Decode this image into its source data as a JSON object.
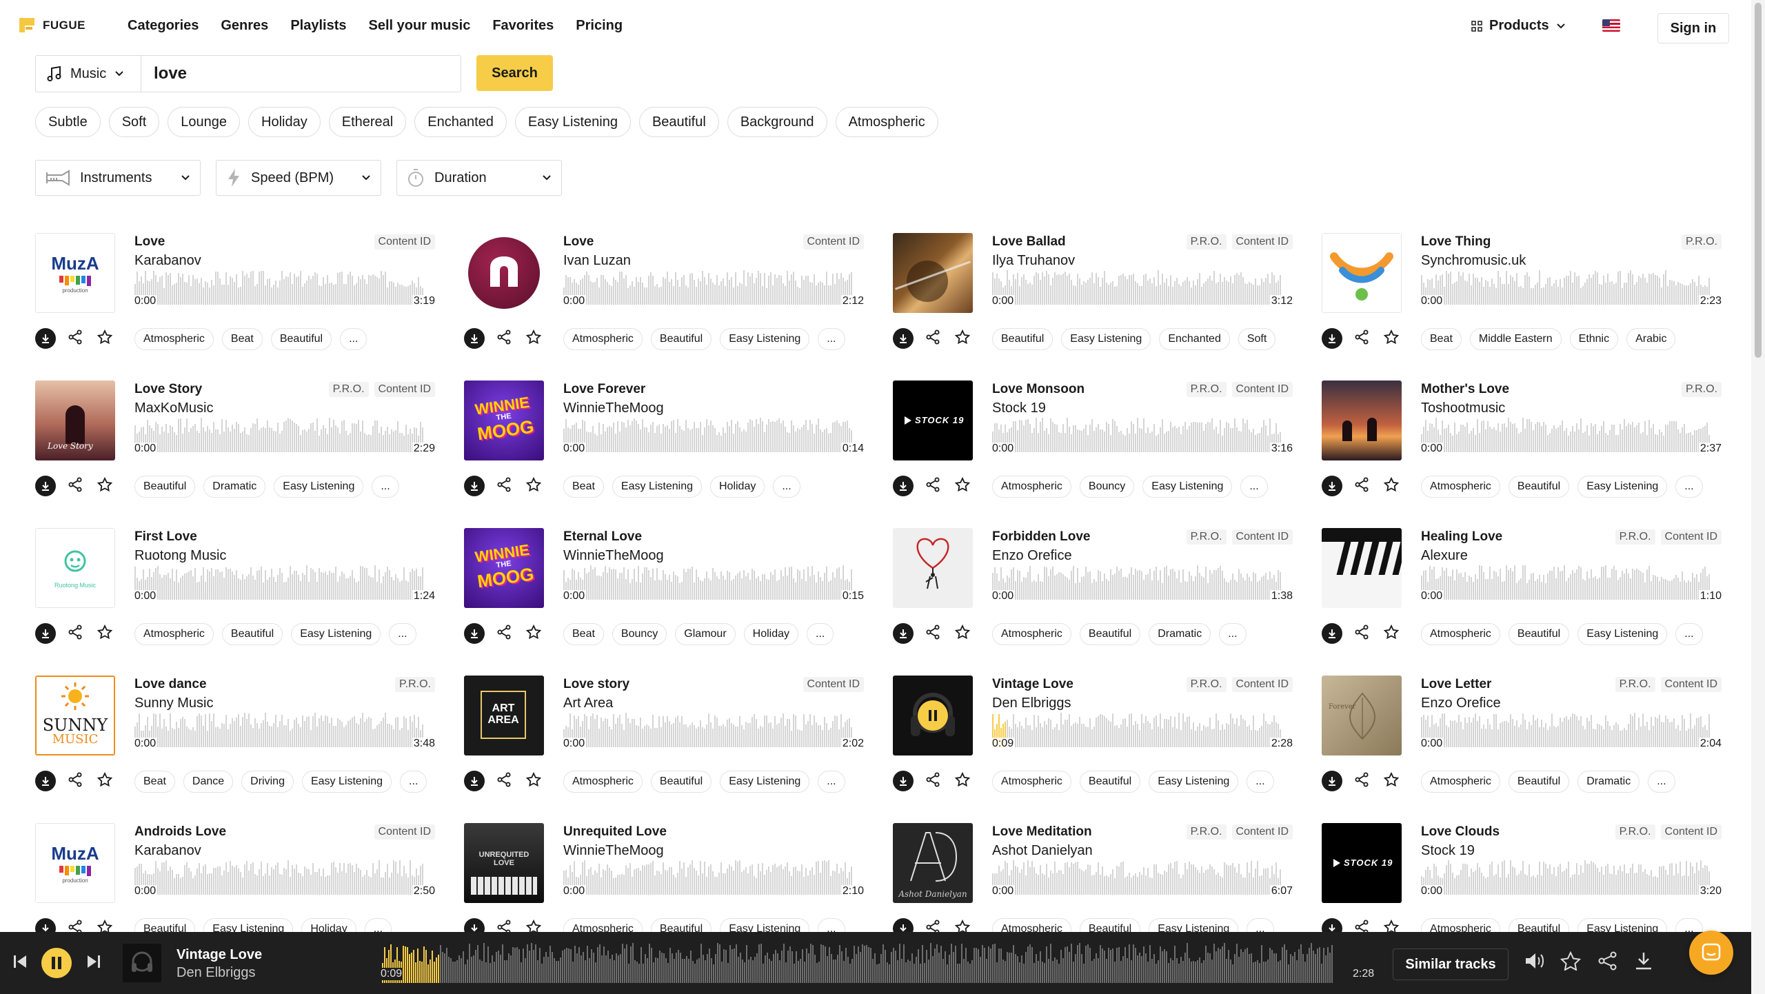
{
  "brand": "FUGUE",
  "nav": [
    "Categories",
    "Genres",
    "Playlists",
    "Sell your music",
    "Favorites",
    "Pricing"
  ],
  "header": {
    "products": "Products",
    "sign_in": "Sign in"
  },
  "search": {
    "type": "Music",
    "query": "love",
    "button": "Search"
  },
  "tags": [
    "Subtle",
    "Soft",
    "Lounge",
    "Holiday",
    "Ethereal",
    "Enchanted",
    "Easy Listening",
    "Beautiful",
    "Background",
    "Atmospheric"
  ],
  "filters": [
    {
      "label": "Instruments",
      "icon": "trumpet-icon"
    },
    {
      "label": "Speed (BPM)",
      "icon": "lightning-icon"
    },
    {
      "label": "Duration",
      "icon": "stopwatch-icon"
    }
  ],
  "tracks": [
    {
      "title": "Love",
      "artist": "Karabanov",
      "pro": false,
      "content_id": true,
      "current": "0:00",
      "duration": "3:19",
      "tags": [
        "Atmospheric",
        "Beat",
        "Beautiful",
        "..."
      ],
      "art": "muza"
    },
    {
      "title": "Love",
      "artist": "Ivan Luzan",
      "pro": false,
      "content_id": true,
      "current": "0:00",
      "duration": "2:12",
      "tags": [
        "Atmospheric",
        "Beautiful",
        "Easy Listening",
        "..."
      ],
      "art": "circle"
    },
    {
      "title": "Love Ballad",
      "artist": "Ilya Truhanov",
      "pro": true,
      "content_id": true,
      "current": "0:00",
      "duration": "3:12",
      "tags": [
        "Beautiful",
        "Easy Listening",
        "Enchanted",
        "Soft"
      ],
      "art": "guitar"
    },
    {
      "title": "Love Thing",
      "artist": "Synchromusic.uk",
      "pro": true,
      "content_id": false,
      "current": "0:00",
      "duration": "2:23",
      "tags": [
        "Beat",
        "Middle Eastern",
        "Ethnic",
        "Arabic"
      ],
      "art": "smile"
    },
    {
      "title": "Love Story",
      "artist": "MaxKoMusic",
      "pro": true,
      "content_id": true,
      "current": "0:00",
      "duration": "2:29",
      "tags": [
        "Beautiful",
        "Dramatic",
        "Easy Listening",
        "..."
      ],
      "art": "couple"
    },
    {
      "title": "Love Forever",
      "artist": "WinnieTheMoog",
      "pro": false,
      "content_id": false,
      "current": "0:00",
      "duration": "0:14",
      "tags": [
        "Beat",
        "Easy Listening",
        "Holiday",
        "..."
      ],
      "art": "winnie"
    },
    {
      "title": "Love Monsoon",
      "artist": "Stock 19",
      "pro": true,
      "content_id": true,
      "current": "0:00",
      "duration": "3:16",
      "tags": [
        "Atmospheric",
        "Bouncy",
        "Easy Listening",
        "..."
      ],
      "art": "stock19"
    },
    {
      "title": "Mother's Love",
      "artist": "Toshootmusic",
      "pro": true,
      "content_id": false,
      "current": "0:00",
      "duration": "2:37",
      "tags": [
        "Atmospheric",
        "Beautiful",
        "Easy Listening",
        "..."
      ],
      "art": "sunset"
    },
    {
      "title": "First Love",
      "artist": "Ruotong Music",
      "pro": false,
      "content_id": false,
      "current": "0:00",
      "duration": "1:24",
      "tags": [
        "Atmospheric",
        "Beautiful",
        "Easy Listening",
        "..."
      ],
      "art": "ruotong"
    },
    {
      "title": "Eternal Love",
      "artist": "WinnieTheMoog",
      "pro": false,
      "content_id": false,
      "current": "0:00",
      "duration": "0:15",
      "tags": [
        "Beat",
        "Bouncy",
        "Glamour",
        "Holiday",
        "..."
      ],
      "art": "winnie"
    },
    {
      "title": "Forbidden Love",
      "artist": "Enzo Orefice",
      "pro": true,
      "content_id": true,
      "current": "0:00",
      "duration": "1:38",
      "tags": [
        "Atmospheric",
        "Beautiful",
        "Dramatic",
        "..."
      ],
      "art": "heart"
    },
    {
      "title": "Healing Love",
      "artist": "Alexure",
      "pro": true,
      "content_id": true,
      "current": "0:00",
      "duration": "1:10",
      "tags": [
        "Atmospheric",
        "Beautiful",
        "Easy Listening",
        "..."
      ],
      "art": "piano"
    },
    {
      "title": "Love dance",
      "artist": "Sunny Music",
      "pro": true,
      "content_id": false,
      "current": "0:00",
      "duration": "3:48",
      "tags": [
        "Beat",
        "Dance",
        "Driving",
        "Easy Listening",
        "..."
      ],
      "art": "sunny"
    },
    {
      "title": "Love story",
      "artist": "Art Area",
      "pro": false,
      "content_id": true,
      "current": "0:00",
      "duration": "2:02",
      "tags": [
        "Atmospheric",
        "Beautiful",
        "Easy Listening",
        "..."
      ],
      "art": "artarea"
    },
    {
      "title": "Vintage Love",
      "artist": "Den Elbriggs",
      "pro": true,
      "content_id": true,
      "current": "0:09",
      "duration": "2:28",
      "tags": [
        "Atmospheric",
        "Beautiful",
        "Easy Listening",
        "..."
      ],
      "art": "playing",
      "playing": true
    },
    {
      "title": "Love Letter",
      "artist": "Enzo Orefice",
      "pro": true,
      "content_id": true,
      "current": "0:00",
      "duration": "2:04",
      "tags": [
        "Atmospheric",
        "Beautiful",
        "Dramatic",
        "..."
      ],
      "art": "letter"
    },
    {
      "title": "Androids Love",
      "artist": "Karabanov",
      "pro": false,
      "content_id": true,
      "current": "0:00",
      "duration": "2:50",
      "tags": [
        "Beautiful",
        "Easy Listening",
        "Holiday",
        "..."
      ],
      "art": "muza"
    },
    {
      "title": "Unrequited Love",
      "artist": "WinnieTheMoog",
      "pro": false,
      "content_id": false,
      "current": "0:00",
      "duration": "2:10",
      "tags": [
        "Atmospheric",
        "Beautiful",
        "Easy Listening",
        "..."
      ],
      "art": "unrequited"
    },
    {
      "title": "Love Meditation",
      "artist": "Ashot Danielyan",
      "pro": true,
      "content_id": true,
      "current": "0:00",
      "duration": "6:07",
      "tags": [
        "Atmospheric",
        "Beautiful",
        "Easy Listening",
        "..."
      ],
      "art": "ashot"
    },
    {
      "title": "Love Clouds",
      "artist": "Stock 19",
      "pro": true,
      "content_id": true,
      "current": "0:00",
      "duration": "3:20",
      "tags": [
        "Atmospheric",
        "Beautiful",
        "Easy Listening",
        "..."
      ],
      "art": "stock19"
    }
  ],
  "labels": {
    "pro": "P.R.O.",
    "content_id": "Content ID"
  },
  "art_text": {
    "muza_name": "MuzA",
    "muza_sub": "production",
    "winnie": [
      "WINNIE",
      "THE",
      "MOOG"
    ],
    "stock19": "STOCK 19",
    "sunny": [
      "SUNNY",
      "MUSIC"
    ],
    "artarea": [
      "ART",
      "AREA"
    ],
    "unrequited": [
      "UNREQUITED",
      "LOVE"
    ],
    "ashot_script": "Ashot Danielyan",
    "ruotong": "Ruotong Music",
    "couple": "Love Story",
    "letter": "Forever"
  },
  "player": {
    "title": "Vintage Love",
    "artist": "Den Elbriggs",
    "current": "0:09",
    "duration": "2:28",
    "progress": 0.061,
    "similar": "Similar tracks",
    "state": "playing"
  },
  "colors": {
    "accent": "#f7cc46",
    "player_bg": "#1f1f1f",
    "chat": "#f7a823"
  },
  "icons": [
    "logo-mark",
    "music-note-icon",
    "chevron-down-icon",
    "grid-icon",
    "flag-us-icon",
    "download-icon",
    "share-icon",
    "star-icon",
    "pause-icon",
    "skip-back-icon",
    "skip-forward-icon",
    "volume-icon",
    "chat-icon"
  ]
}
